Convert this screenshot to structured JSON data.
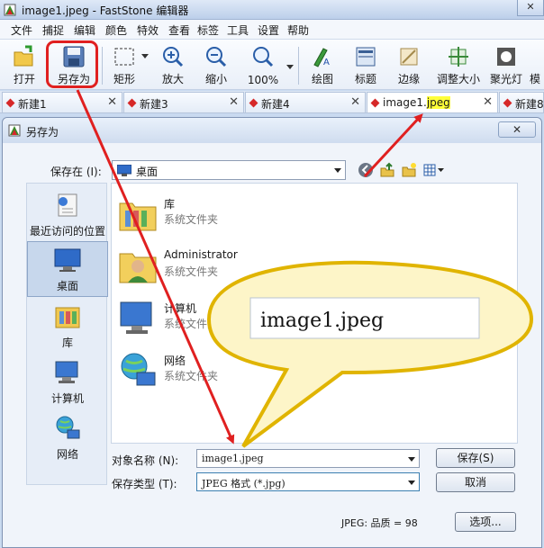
{
  "window": {
    "title": "image1.jpeg - FastStone 编辑器",
    "controls": [
      "–",
      "□",
      "✕"
    ]
  },
  "menu": [
    "文件",
    "捕捉",
    "编辑",
    "颜色",
    "特效",
    "查看",
    "标签",
    "工具",
    "设置",
    "帮助"
  ],
  "toolbar": {
    "open": "打开",
    "save_as": "另存为",
    "rect": "矩形",
    "zoom_in": "放大",
    "zoom_out": "缩小",
    "zoom_100": "100%",
    "draw": "绘图",
    "caption": "标题",
    "edge": "边缘",
    "resize": "调整大小",
    "spotlight": "聚光灯",
    "more": "模"
  },
  "tabs": [
    {
      "label": "新建1"
    },
    {
      "label": "新建3"
    },
    {
      "label": "新建4"
    },
    {
      "label_main": "image1.",
      "label_ext": "jpeg"
    },
    {
      "label": "新建8"
    }
  ],
  "dialog": {
    "title": "另存为",
    "close": "✕",
    "save_in_label": "保存在 (I):",
    "save_in_value": "桌面",
    "places": [
      {
        "label": "最近访问的位置",
        "icon": "recent-places-icon"
      },
      {
        "label": "桌面",
        "icon": "desktop-icon"
      },
      {
        "label": "库",
        "icon": "libraries-icon"
      },
      {
        "label": "计算机",
        "icon": "computer-icon"
      },
      {
        "label": "网络",
        "icon": "network-icon"
      }
    ],
    "files": [
      {
        "name": "库",
        "type": "系统文件夹",
        "icon": "libraries-folder-icon"
      },
      {
        "name": "Administrator",
        "type": "系统文件夹",
        "icon": "user-folder-icon"
      },
      {
        "name": "计算机",
        "type": "系统文件夹",
        "icon": "computer-icon"
      },
      {
        "name": "网络",
        "type": "系统文件夹",
        "icon": "network-icon"
      }
    ],
    "filename_label": "对象名称 (N):",
    "filename_value": "image1.jpeg",
    "filetype_label": "保存类型 (T):",
    "filetype_value": "JPEG 格式 (*.jpg)",
    "save_button": "保存(S)",
    "cancel_button": "取消",
    "quality_text": "JPEG: 品质 = 98",
    "options_button": "选项..."
  },
  "callout": {
    "text": "image1.jpeg"
  },
  "colors": {
    "annotation_red": "#e02020",
    "callout_fill": "#fdf5c8",
    "callout_stroke": "#e0b400",
    "highlight_yellow": "#ffff3a"
  }
}
